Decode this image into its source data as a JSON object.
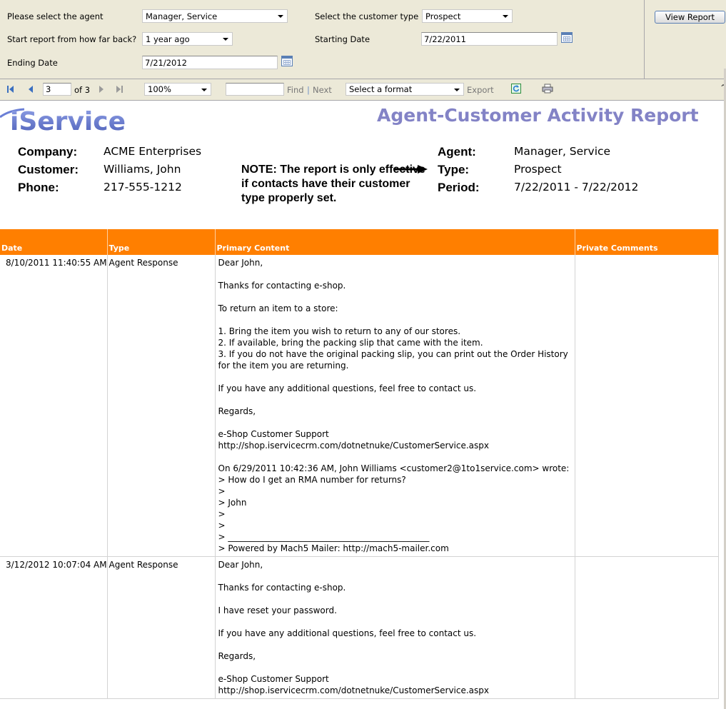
{
  "params": {
    "agent_label": "Please select the agent",
    "agent_value": "Manager, Service",
    "customer_type_label": "Select the customer type",
    "customer_type_value": "Prospect",
    "start_back_label": "Start report from how far back?",
    "start_back_value": "1 year ago",
    "starting_date_label": "Starting Date",
    "starting_date_value": "7/22/2011",
    "ending_date_label": "Ending Date",
    "ending_date_value": "7/21/2012",
    "view_report_label": "View Report"
  },
  "toolbar": {
    "page_value": "3",
    "page_of": "of 3",
    "zoom_value": "100%",
    "find_value": "",
    "find_label": "Find",
    "separator": "|",
    "next_label": "Next",
    "format_value": "Select a format",
    "export_label": "Export",
    "icons": [
      "first-page-icon",
      "previous-page-icon",
      "next-page-icon",
      "last-page-icon",
      "refresh-icon",
      "print-icon"
    ]
  },
  "report": {
    "logo_text": "iService",
    "title": "Agent-Customer Activity Report",
    "company_label": "Company:",
    "company_value": "ACME Enterprises",
    "customer_label": "Customer:",
    "customer_value": "Williams, John",
    "phone_label": "Phone:",
    "phone_value": "217-555-1212",
    "agent_label": "Agent:",
    "agent_value": "Manager, Service",
    "type_label": "Type:",
    "type_value": "Prospect",
    "period_label": "Period:",
    "period_value": "7/22/2011 - 7/22/2012",
    "note": "NOTE: The report is only effective if contacts have their customer type properly set.",
    "columns": [
      "Date",
      "Type",
      "Primary Content",
      "Private Comments"
    ],
    "rows": [
      {
        "date": "8/10/2011 11:40:55 AM",
        "type": "Agent Response",
        "content": "Dear John,\n\nThanks for contacting e-shop.\n\nTo return an item to a store:\n\n1. Bring the item you wish to return to any of our stores.\n2. If available, bring the packing slip that came with the item.\n3. If you do not have the original packing slip, you can print out the Order History for the item you are returning.\n\nIf you have any additional questions, feel free to contact us.\n\nRegards,\n\ne-Shop Customer Support\nhttp://shop.iservicecrm.com/dotnetnuke/CustomerService.aspx\n\nOn 6/29/2011 10:42:36 AM, John Williams <customer2@1to1service.com> wrote:\n> How do I get an RMA number for returns?\n>\n> John\n>\n>\n> _______________________________________________\n> Powered by Mach5 Mailer: http://mach5-mailer.com",
        "comments": ""
      },
      {
        "date": "3/12/2012 10:07:04 AM",
        "type": "Agent Response",
        "content": "Dear John,\n\nThanks for contacting e-shop.\n\nI have reset your password.\n\nIf you have any additional questions, feel free to contact us.\n\nRegards,\n\ne-Shop Customer Support\nhttp://shop.iservicecrm.com/dotnetnuke/CustomerService.aspx",
        "comments": ""
      }
    ]
  },
  "colors": {
    "header_orange": "#ff7f00",
    "title_purple": "#8383c6",
    "panel_bg": "#ece9d8",
    "logo_blue": "#5e6ebf"
  }
}
